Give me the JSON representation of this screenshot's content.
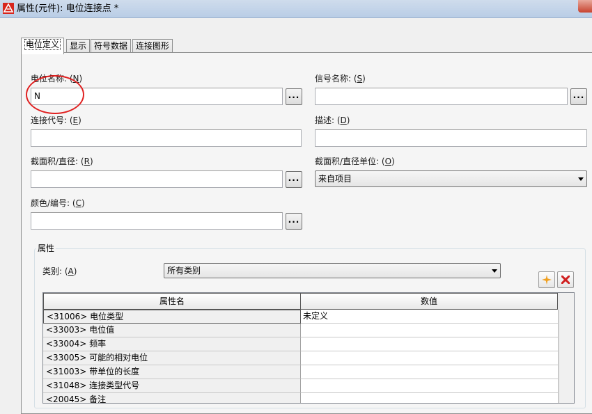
{
  "window": {
    "title": "属性(元件): 电位连接点 *",
    "icon": "app-logo-icon"
  },
  "tabs": [
    {
      "label": "电位定义",
      "active": true
    },
    {
      "label": "显示",
      "active": false
    },
    {
      "label": "符号数据",
      "active": false
    },
    {
      "label": "连接图形",
      "active": false
    }
  ],
  "fields": {
    "potential_name": {
      "label": "电位名称:",
      "key": "N",
      "value": "N"
    },
    "signal_name": {
      "label": "信号名称:",
      "key": "S",
      "value": ""
    },
    "connection_code": {
      "label": "连接代号:",
      "key": "E",
      "value": ""
    },
    "description": {
      "label": "描述:",
      "key": "D",
      "value": ""
    },
    "cross_section": {
      "label": "截面积/直径:",
      "key": "R",
      "value": ""
    },
    "cross_section_unit": {
      "label": "截面积/直径单位:",
      "key": "O",
      "value": "来自项目"
    },
    "color_number": {
      "label": "颜色/编号:",
      "key": "C",
      "value": ""
    }
  },
  "dots_label": "...",
  "properties": {
    "group_title": "属性",
    "category_label": "类别:",
    "category_key": "A",
    "category_value": "所有类别",
    "columns": [
      "属性名",
      "数值"
    ],
    "rows": [
      {
        "name": "<31006> 电位类型",
        "value": "未定义"
      },
      {
        "name": "<33003> 电位值",
        "value": ""
      },
      {
        "name": "<33004> 频率",
        "value": ""
      },
      {
        "name": "<33005> 可能的相对电位",
        "value": ""
      },
      {
        "name": "<31003> 带单位的长度",
        "value": ""
      },
      {
        "name": "<31048> 连接类型代号",
        "value": ""
      },
      {
        "name": "<20045> 备注",
        "value": ""
      }
    ]
  },
  "colors": {
    "highlight": "#e02020",
    "new_icon": "#f0a020",
    "delete_icon": "#d02020"
  }
}
